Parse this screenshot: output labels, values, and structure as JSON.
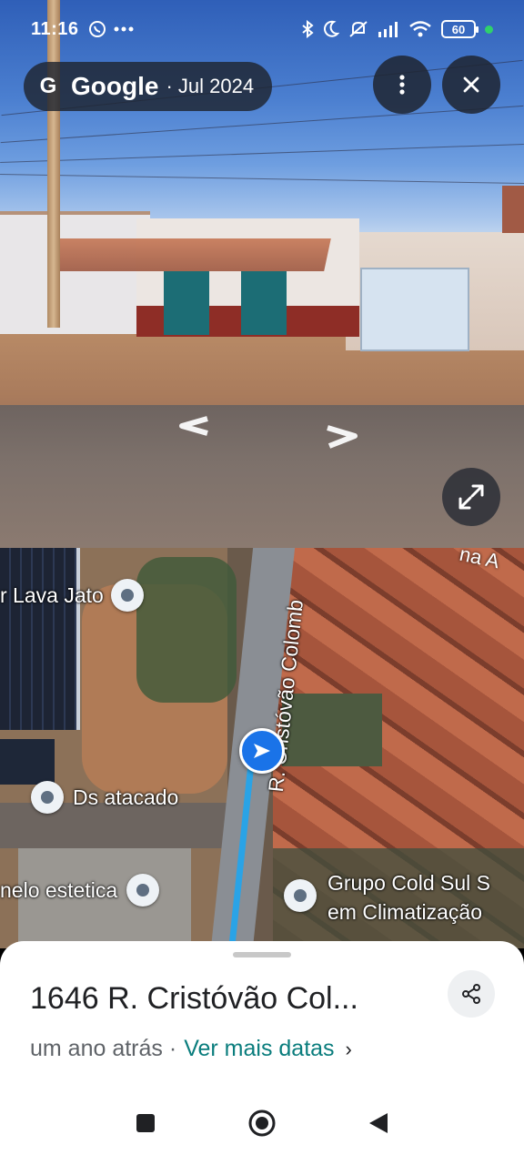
{
  "status_bar": {
    "time": "11:16",
    "battery": "60",
    "icons": [
      "whatsapp-icon",
      "more-dots-icon",
      "bluetooth-icon",
      "moon-icon",
      "mute-icon",
      "signal-icon",
      "wifi-icon",
      "battery-icon"
    ]
  },
  "top_bar": {
    "logo": "G",
    "brand": "Google",
    "date": "· Jul 2024"
  },
  "map": {
    "street_label": "R. Cristóvão Colomb",
    "corner_street": "na A",
    "pois": [
      {
        "label": "r Lava Jato"
      },
      {
        "label": "Ds atacado"
      },
      {
        "label": "nelo estetica"
      }
    ],
    "poi_multiline": {
      "line1": "Grupo Cold Sul S",
      "line2": "em Climatização"
    }
  },
  "sheet": {
    "address": "1646 R. Cristóvão Col...",
    "time_ago": "um ano atrás ·",
    "more_dates": "Ver mais datas",
    "chevron": "›"
  },
  "colors": {
    "accent_link": "#0a7d7d",
    "you_marker": "#1a73e8",
    "route_line": "#2aa3e6"
  }
}
